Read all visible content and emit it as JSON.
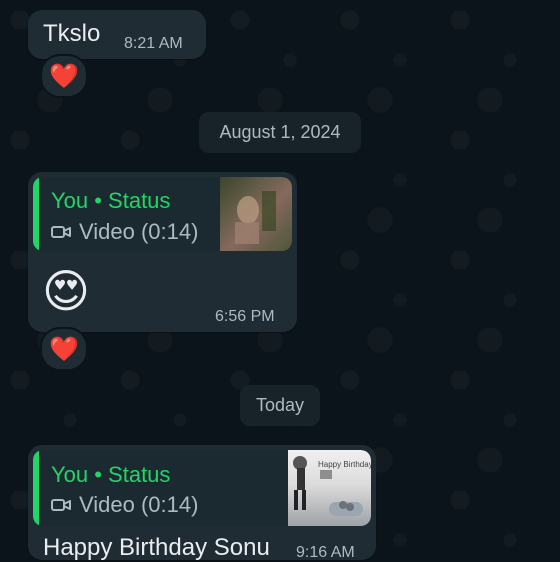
{
  "messages": {
    "m1": {
      "text": "Tkslo",
      "time": "8:21 AM",
      "reaction": "❤️"
    },
    "date1": "August 1, 2024",
    "m2": {
      "quote_author": "You • Status",
      "quote_type": "Video (0:14)",
      "emoji": "😍",
      "time": "6:56 PM",
      "reaction": "❤️"
    },
    "date2": "Today",
    "m3": {
      "quote_author": "You • Status",
      "quote_type": "Video (0:14)",
      "text": "Happy Birthday Sonu",
      "time": "9:16 AM",
      "thumb_text": "Happy Birthday"
    }
  },
  "icons": {
    "video_icon": "video-camera-icon",
    "heart_icon": "heart-icon",
    "emoji_icon": "heart-eyes-emoji-icon"
  },
  "colors": {
    "background": "#0b141a",
    "bubble": "#202c33",
    "accent": "#25d366",
    "muted_text": "#aebac1"
  }
}
